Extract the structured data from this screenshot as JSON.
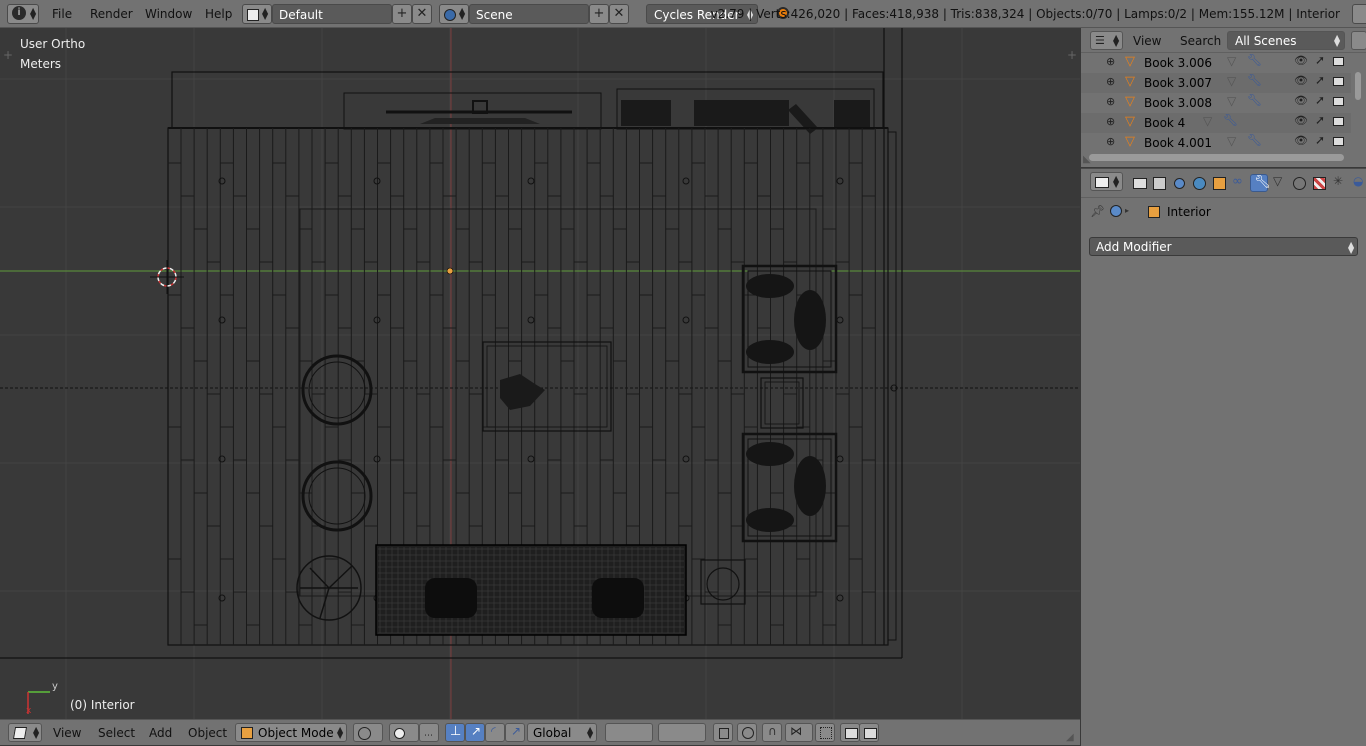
{
  "top_header": {
    "menus": [
      "File",
      "Render",
      "Window",
      "Help"
    ],
    "screen_layout": "Default",
    "scene": "Scene",
    "render_engine": "Cycles Render",
    "stats": "v2.79 | Verts:426,020 | Faces:418,938 | Tris:838,324 | Objects:0/70 | Lamps:0/2 | Mem:155.12M | Interior"
  },
  "viewport": {
    "view_name": "User Ortho",
    "units": "Meters",
    "active_object": "(0) Interior",
    "axis_x": "x",
    "axis_y": "y",
    "colors": {
      "background": "#393939",
      "x_axis": "#8b3a3a",
      "y_axis": "#5a9a3a",
      "wire": "#000000"
    }
  },
  "viewport_header": {
    "menus": [
      "View",
      "Select",
      "Add",
      "Object"
    ],
    "mode": "Object Mode",
    "orientation": "Global"
  },
  "outliner": {
    "menus": [
      "View",
      "Search"
    ],
    "display_mode": "All Scenes",
    "items": [
      {
        "name": "Book 3.006"
      },
      {
        "name": "Book 3.007"
      },
      {
        "name": "Book 3.008"
      },
      {
        "name": "Book 4"
      },
      {
        "name": "Book 4.001"
      }
    ]
  },
  "properties": {
    "context_object": "Interior",
    "add_modifier_label": "Add Modifier",
    "active_tab": "modifiers-tab"
  }
}
